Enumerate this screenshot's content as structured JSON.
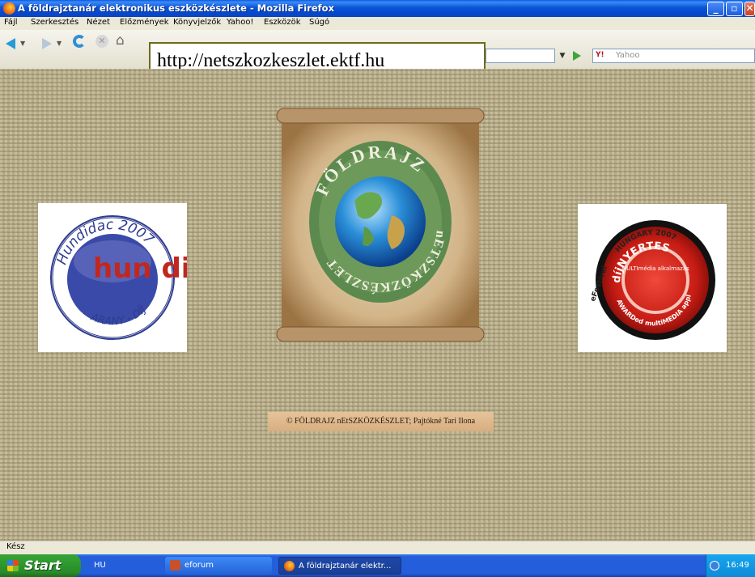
{
  "window": {
    "title": "A földrajztanár elektronikus eszközkészlete - Mozilla Firefox",
    "controls": {
      "minimize": "_",
      "maximize": "▫",
      "close": "✕"
    }
  },
  "menu": [
    "Fájl",
    "Szerkesztés",
    "Nézet",
    "Előzmények",
    "Könyvjelzők",
    "Yahoo!",
    "Eszközök",
    "Súgó"
  ],
  "toolbar": {
    "url": "http://netszkozkeszlet.ektf.hu",
    "search_placeholder": "Yahoo",
    "search_engine_icon": "Y!"
  },
  "page": {
    "logo_left": {
      "top_text": "Hundidac 2007",
      "middle_text": "hun didac",
      "bottom_text": "ARANY - DÍJ"
    },
    "center_logo": {
      "top_text": "FÖLDRAJZ",
      "bottom_text": "nETSZKÖZKÉSZLET"
    },
    "logo_right": {
      "top_text": "HUNGARY 2007",
      "line1": "díjNYERTES",
      "line2": "MULTImédia alkalmazás",
      "line3": "AWARDed multiMEDIA application",
      "side": "eFestival"
    },
    "copyright": "© FÖLDRAJZ nEtSZKÖZKÉSZLET; Pajtókné Tari Ilona"
  },
  "statusbar": {
    "text": "Kész"
  },
  "taskbar": {
    "start_label": "Start",
    "language": "HU",
    "tasks": [
      {
        "label": "eforum"
      },
      {
        "label": "A földrajztanár elektr..."
      }
    ],
    "clock": "16:49"
  },
  "colors": {
    "titlebar": "#0953d8",
    "start": "#32a232",
    "scroll": "#d9c19a",
    "ring": "#5c8a4e"
  }
}
